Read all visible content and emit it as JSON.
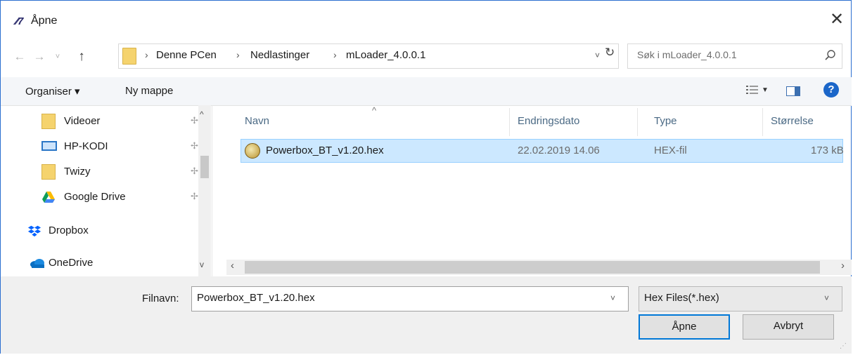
{
  "window": {
    "title": "Åpne",
    "app_icon": "app-logo-icon",
    "close_label": "✕"
  },
  "address": {
    "crumbs": [
      "Denne PCen",
      "Nedlastinger",
      "mLoader_4.0.0.1"
    ],
    "separator": "›",
    "search_placeholder": "Søk i mLoader_4.0.0.1"
  },
  "toolbar": {
    "organize_label": "Organiser ▾",
    "new_folder_label": "Ny mappe"
  },
  "nav_pane": {
    "items": [
      {
        "label": "Videoer",
        "icon": "folder-icon",
        "pinned": true
      },
      {
        "label": "HP-KODI",
        "icon": "pc-icon",
        "pinned": true
      },
      {
        "label": "Twizy",
        "icon": "folder-icon",
        "pinned": true
      },
      {
        "label": "Google Drive",
        "icon": "google-drive-icon",
        "pinned": true
      },
      {
        "label": "Dropbox",
        "icon": "dropbox-icon",
        "pinned": false
      },
      {
        "label": "OneDrive",
        "icon": "onedrive-icon",
        "pinned": false
      }
    ]
  },
  "file_list": {
    "columns": [
      "Navn",
      "Endringsdato",
      "Type",
      "Størrelse"
    ],
    "rows": [
      {
        "name": "Powerbox_BT_v1.20.hex",
        "date": "22.02.2019 14.06",
        "type": "HEX-fil",
        "size": "173 kB",
        "selected": true
      }
    ]
  },
  "bottom": {
    "filename_label": "Filnavn:",
    "filename_value": "Powerbox_BT_v1.20.hex",
    "filetype_value": "Hex Files(*.hex)",
    "open_label": "Åpne",
    "cancel_label": "Avbryt"
  },
  "colors": {
    "accent": "#0078d7",
    "selection": "#cce8ff",
    "folder": "#f5d36e"
  }
}
